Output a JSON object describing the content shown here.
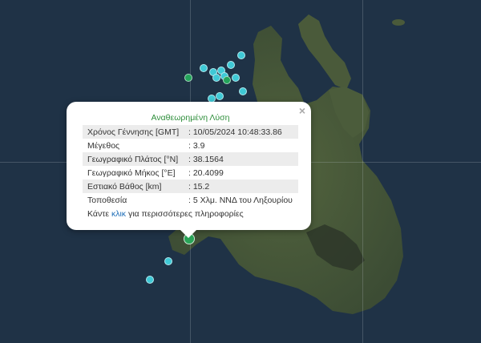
{
  "popup": {
    "title": "Αναθεωρημένη Λύση",
    "close_glyph": "×",
    "rows": [
      {
        "label": "Χρόνος Γέννησης [GMT]",
        "value": ": 10/05/2024 10:48:33.86"
      },
      {
        "label": "Μέγεθος",
        "value": ": 3.9"
      },
      {
        "label": "Γεωγραφικό Πλάτος [°N]",
        "value": ": 38.1564"
      },
      {
        "label": "Γεωγραφικό Μήκος [°E]",
        "value": ": 20.4099"
      },
      {
        "label": "Εστιακό Βάθος [km]",
        "value": ": 15.2"
      },
      {
        "label": "Τοποθεσία",
        "value": ": 5 Χλμ. ΝΝΔ του Ληξουρίου"
      }
    ],
    "more_prefix": "Κάντε ",
    "more_link": "κλικ",
    "more_suffix": " για περισσότερες πληροφορίες"
  },
  "colors": {
    "sea": "#1f3246",
    "land": "#4a5a3a",
    "title_green": "#2f8f3c",
    "quake_cyan": "#3fc9d6",
    "quake_green": "#29a457",
    "link": "#1f6fb8"
  }
}
